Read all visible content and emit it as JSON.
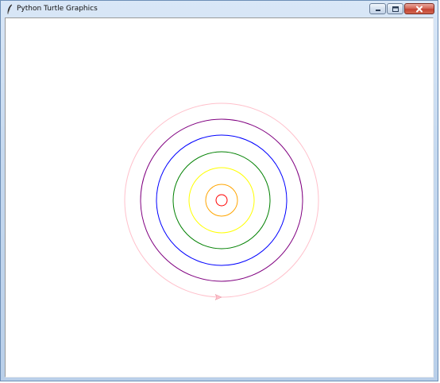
{
  "window": {
    "title": "Python Turtle Graphics",
    "app_icon": "feather-icon"
  },
  "controls": {
    "minimize_icon": "minimize-icon",
    "maximize_icon": "maximize-icon",
    "close_icon": "close-icon"
  },
  "canvas": {
    "background": "#ffffff",
    "rings": [
      {
        "color": "#ff0000"
      },
      {
        "color": "#ffa500"
      },
      {
        "color": "#ffff00"
      },
      {
        "color": "#008000"
      },
      {
        "color": "#0000ff"
      },
      {
        "color": "#800080"
      },
      {
        "color": "#ffc0cb"
      }
    ],
    "turtle": {
      "color": "#ffc0cb",
      "shape": "arrow",
      "heading": "east"
    }
  }
}
